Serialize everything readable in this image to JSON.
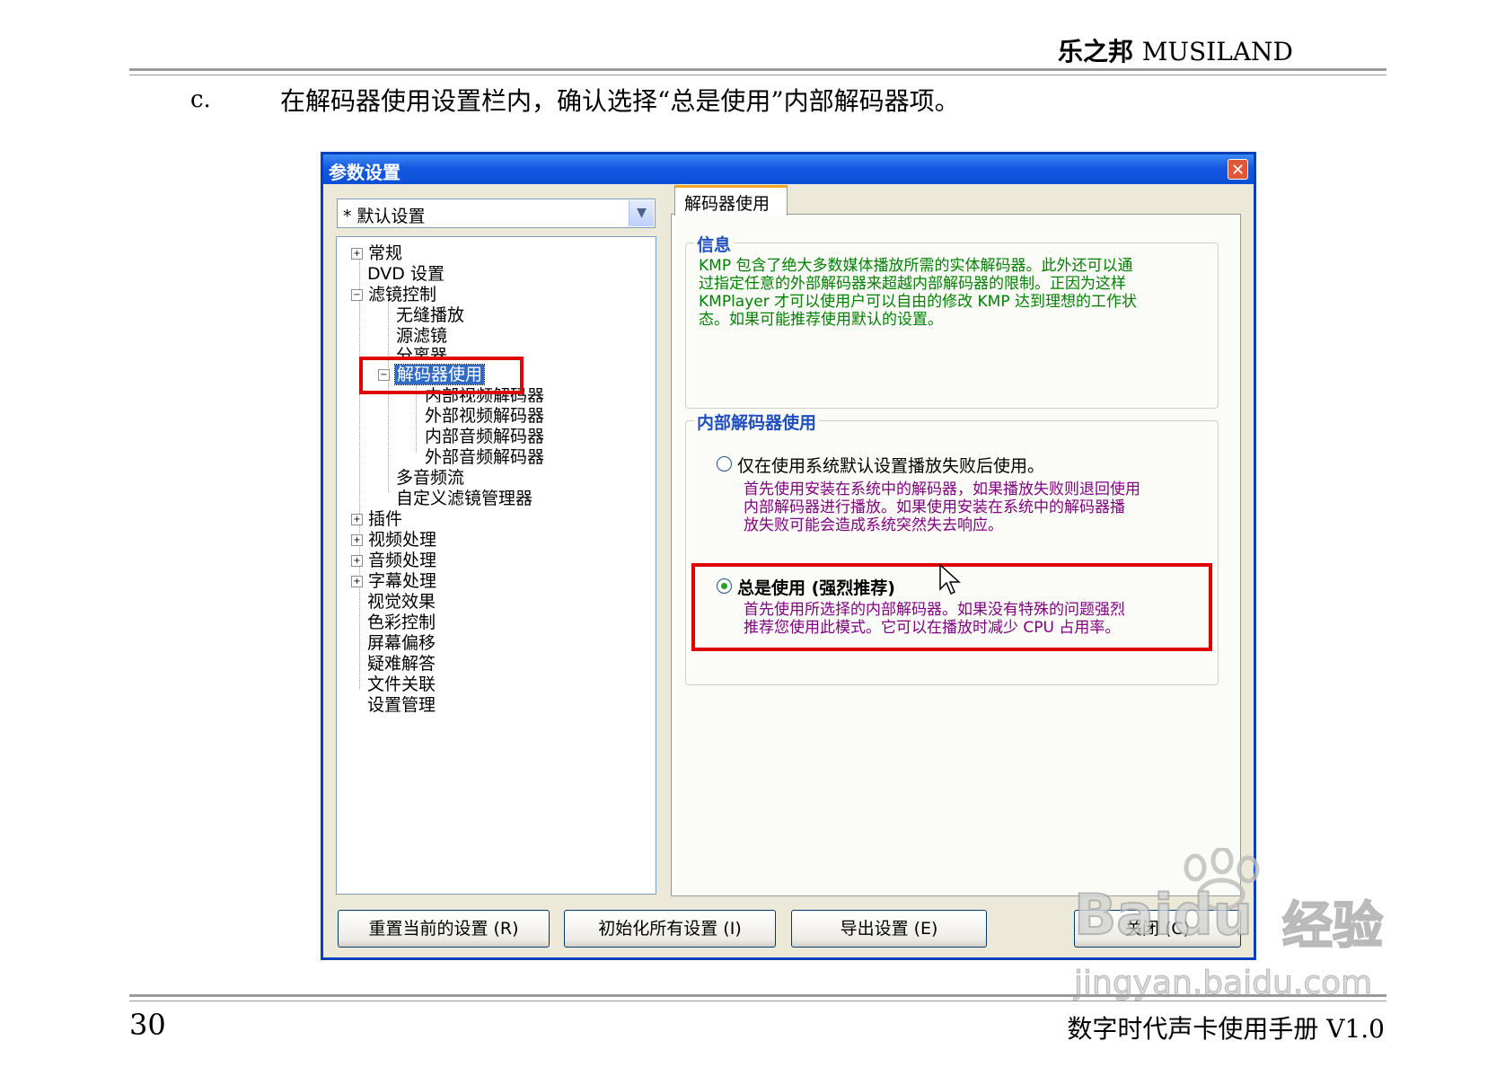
{
  "header": {
    "brand_cn": "乐之邦",
    "brand_en": "MUSILAND"
  },
  "step": {
    "letter": "c.",
    "text": "在解码器使用设置栏内，确认选择“总是使用”内部解码器项。"
  },
  "dialog": {
    "title": "参数设置",
    "preset": "* 默认设置",
    "tree": [
      {
        "label": "常规"
      },
      {
        "label": "DVD 设置"
      },
      {
        "label": "滤镜控制"
      },
      {
        "label": "无缝播放"
      },
      {
        "label": "源滤镜"
      },
      {
        "label": "分离器"
      },
      {
        "label": "解码器使用"
      },
      {
        "label": "内部视频解码器"
      },
      {
        "label": "外部视频解码器"
      },
      {
        "label": "内部音频解码器"
      },
      {
        "label": "外部音频解码器"
      },
      {
        "label": "多音频流"
      },
      {
        "label": "自定义滤镜管理器"
      },
      {
        "label": "插件"
      },
      {
        "label": "视频处理"
      },
      {
        "label": "音频处理"
      },
      {
        "label": "字幕处理"
      },
      {
        "label": "视觉效果"
      },
      {
        "label": "色彩控制"
      },
      {
        "label": "屏幕偏移"
      },
      {
        "label": "疑难解答"
      },
      {
        "label": "文件关联"
      },
      {
        "label": "设置管理"
      }
    ],
    "tab": "解码器使用",
    "info": {
      "title": "信息",
      "lines": [
        "KMP 包含了绝大多数媒体播放所需的实体解码器。此外还可以通",
        "过指定任意的外部解码器来超越内部解码器的限制。正因为这样",
        "KMPlayer 才可以使用户可以自由的修改 KMP 达到理想的工作状",
        "态。如果可能推荐使用默认的设置。"
      ]
    },
    "internal": {
      "title": "内部解码器使用",
      "option1": {
        "label": "仅在使用系统默认设置播放失败后使用。",
        "desc": [
          "首先使用安装在系统中的解码器，如果播放失败则退回使用",
          "内部解码器进行播放。如果使用安装在系统中的解码器播",
          "放失败可能会造成系统突然失去响应。"
        ]
      },
      "option2": {
        "label": "总是使用 (强烈推荐)",
        "desc": [
          "首先使用所选择的内部解码器。如果没有特殊的问题强烈",
          "推荐您使用此模式。它可以在播放时减少 CPU 占用率。"
        ]
      }
    },
    "buttons": {
      "reset": "重置当前的设置 (R)",
      "init": "初始化所有设置 (I)",
      "export": "导出设置 (E)",
      "close": "关闭 (C)"
    }
  },
  "watermark": {
    "brand": "Baidu",
    "cn": "经验",
    "url": "jingyan.baidu.com"
  },
  "footer": {
    "page": "30",
    "title": "数字时代声卡使用手册 V1.0"
  }
}
